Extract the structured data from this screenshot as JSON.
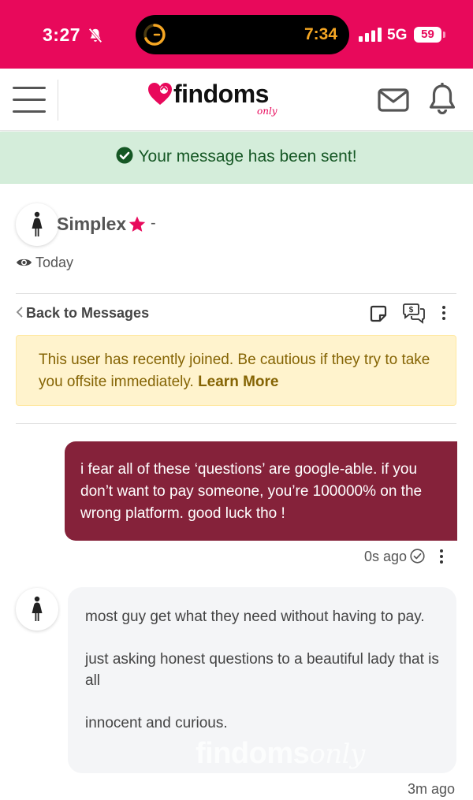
{
  "status_bar": {
    "time": "3:27",
    "live_activity_time": "7:34",
    "network": "5G",
    "battery": "59",
    "accent_color": "#e8095b"
  },
  "header": {
    "brand": "findoms",
    "brand_sub": "only",
    "icons": [
      "menu-icon",
      "mail-icon",
      "bell-icon"
    ]
  },
  "alert": {
    "text": "Your message has been sent!"
  },
  "conversation": {
    "username": "Simplex",
    "separator": "-",
    "last_seen": "Today",
    "back_label": "Back to Messages",
    "warning_text": "This user has recently joined. Be cautious if they try to take you offsite immediately.",
    "warning_link": "Learn More"
  },
  "messages": [
    {
      "direction": "outgoing",
      "text": "i fear all of these ‘questions’ are google-able. if you don’t want to pay someone, you’re 100000% on the wrong platform. good luck tho !",
      "time": "0s ago"
    },
    {
      "direction": "incoming",
      "paragraphs": [
        "most guy get what they need without having to pay.",
        "just asking honest questions to a beautiful lady that is all",
        "innocent and curious."
      ],
      "time": "3m ago"
    }
  ],
  "watermark": {
    "text": "findoms",
    "sub": "only"
  }
}
